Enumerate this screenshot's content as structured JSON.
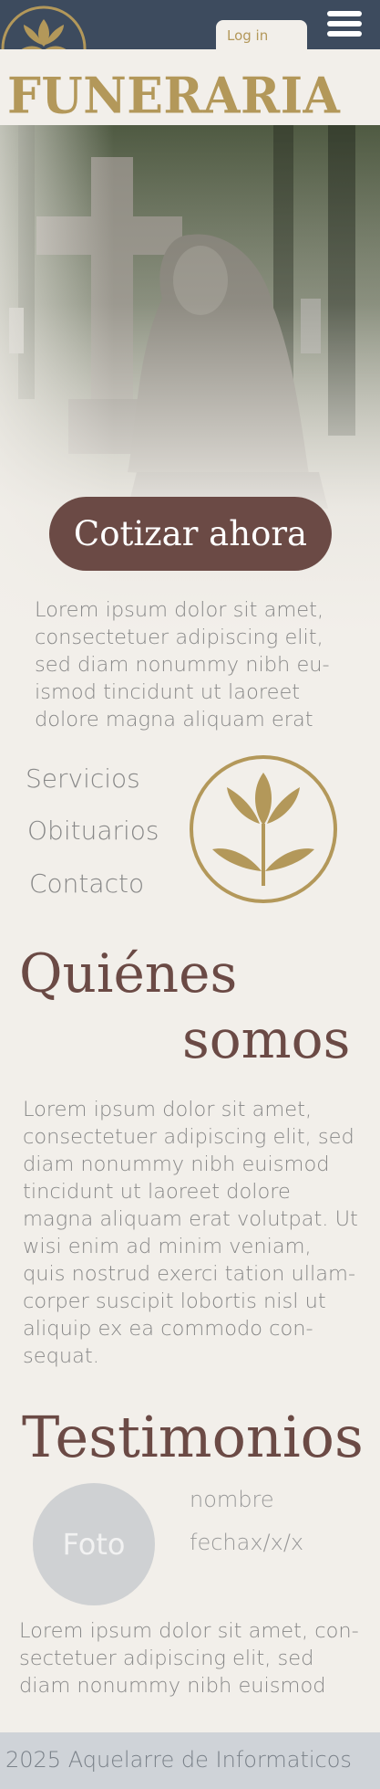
{
  "header": {
    "login_label": "Log in",
    "brand_title": "FUNERARIA"
  },
  "hero": {
    "cta_label": "Cotizar ahora",
    "intro_text": "Lorem ipsum dolor sit amet, consectetuer adipiscing elit, sed diam nonummy nibh eu-ismod tincidunt ut laoreet dolore magna aliquam erat"
  },
  "nav": {
    "items": [
      {
        "label": "Servicios"
      },
      {
        "label": "Obituarios"
      },
      {
        "label": "Contacto"
      }
    ]
  },
  "about": {
    "title_line1": "Quiénes",
    "title_line2": "somos",
    "body": "Lorem ipsum dolor sit amet, consectetuer adipiscing elit, sed diam nonummy nibh euismod tincidunt ut laoreet dolore magna aliquam erat volutpat. Ut wisi enim ad minim veniam, quis nostrud exerci tation ullam-corper suscipit lobortis nisl ut aliquip ex ea commodo con-sequat."
  },
  "testimonials": {
    "title": "Testimonios",
    "photo_label": "Foto",
    "name": "nombre",
    "date": "fechax/x/x",
    "text": "Lorem ipsum dolor sit amet, con-sectetuer adipiscing elit, sed diam nonummy nibh euismod"
  },
  "footer": {
    "text": "2025 Aquelarre de Informaticos"
  },
  "colors": {
    "header_bg": "#3d4b5e",
    "page_bg": "#f2efea",
    "gold": "#b3985a",
    "brown": "#6b4a45",
    "footer_bg": "#cfd3d8"
  },
  "icons": {
    "logo": "lily-logo-icon",
    "menu": "hamburger-menu-icon",
    "emblem": "lily-emblem-icon"
  }
}
